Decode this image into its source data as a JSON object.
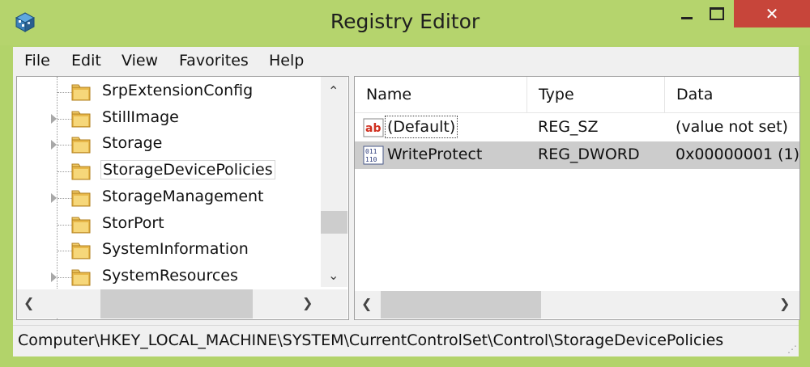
{
  "window": {
    "title": "Registry Editor",
    "icon": "regedit-icon",
    "accent_color": "#b5d46d",
    "close_color": "#c7453a",
    "close_glyph": "✕"
  },
  "menu": [
    "File",
    "Edit",
    "View",
    "Favorites",
    "Help"
  ],
  "tree": {
    "items": [
      {
        "label": "SrpExtensionConfig",
        "expandable": false
      },
      {
        "label": "StillImage",
        "expandable": true
      },
      {
        "label": "Storage",
        "expandable": true
      },
      {
        "label": "StorageDevicePolicies",
        "expandable": false,
        "selected": true
      },
      {
        "label": "StorageManagement",
        "expandable": true
      },
      {
        "label": "StorPort",
        "expandable": false
      },
      {
        "label": "SystemInformation",
        "expandable": false
      },
      {
        "label": "SystemResources",
        "expandable": true
      }
    ]
  },
  "list": {
    "columns": [
      "Name",
      "Type",
      "Data"
    ],
    "rows": [
      {
        "icon": "string-value-icon",
        "name": "(Default)",
        "type": "REG_SZ",
        "data": "(value not set)",
        "selected": false
      },
      {
        "icon": "binary-value-icon",
        "name": "WriteProtect",
        "type": "REG_DWORD",
        "data": "0x00000001 (1)",
        "selected": true
      }
    ]
  },
  "status": {
    "path": "Computer\\HKEY_LOCAL_MACHINE\\SYSTEM\\CurrentControlSet\\Control\\StorageDevicePolicies"
  }
}
